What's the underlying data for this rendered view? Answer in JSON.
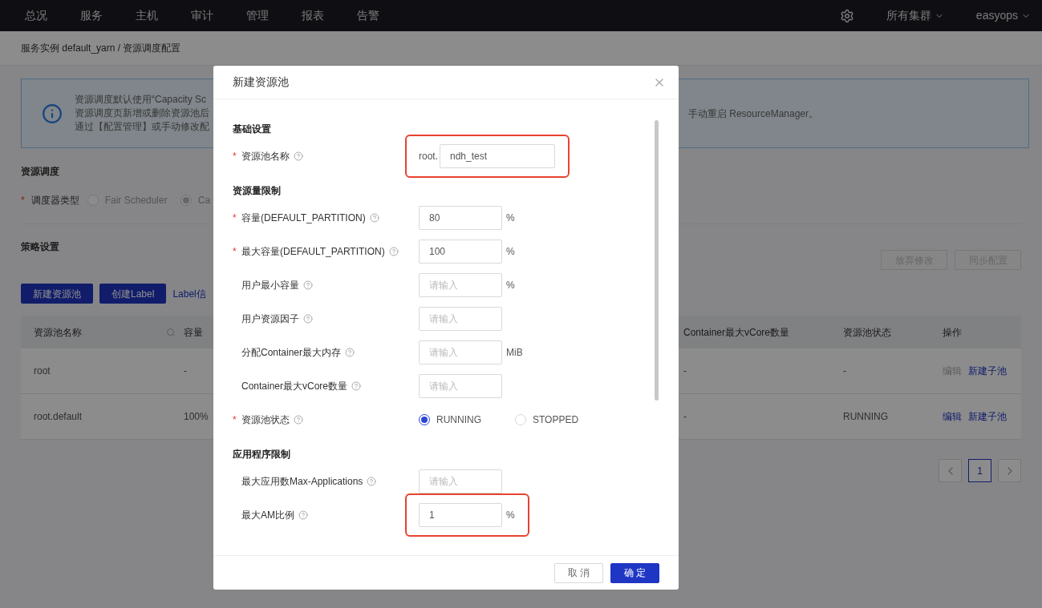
{
  "nav": {
    "items": [
      {
        "label": "总况"
      },
      {
        "label": "服务"
      },
      {
        "label": "主机"
      },
      {
        "label": "审计"
      },
      {
        "label": "管理"
      },
      {
        "label": "报表"
      },
      {
        "label": "告警"
      }
    ],
    "cluster_menu": "所有集群",
    "user_menu": "easyops"
  },
  "breadcrumb": "服务实例 default_yarn / 资源调度配置",
  "notice": {
    "lines": [
      "资源调度默认使用“Capacity Sc",
      "资源调度页新增或删除资源池后",
      "通过【配置管理】或手动修改配"
    ],
    "right_text": "手动重启 ResourceManager。"
  },
  "scheduling": {
    "heading": "资源调度",
    "label": "调度器类型",
    "required_mark": "*",
    "options": [
      {
        "label": "Fair Scheduler",
        "selected": false
      },
      {
        "label": "Ca",
        "selected": true
      }
    ]
  },
  "policy": {
    "heading": "策略设置",
    "actions": [
      {
        "label": "放弃修改",
        "disabled": true
      },
      {
        "label": "同步配置",
        "disabled": true
      }
    ],
    "buttons": [
      "新建资源池",
      "创建Label"
    ],
    "link": "Label信"
  },
  "table": {
    "columns_left": [
      "资源池名称",
      "容量"
    ],
    "columns_right": [
      "Container最大vCore数量",
      "资源池状态",
      "操作"
    ],
    "rows": [
      {
        "name": "root",
        "capacity": "-",
        "max_vcores": "-",
        "status": "-",
        "actions": [
          {
            "label": "编辑",
            "disabled": true
          },
          {
            "label": "新建子池",
            "disabled": false
          }
        ]
      },
      {
        "name": "root.default",
        "capacity": "100%",
        "max_vcores": "-",
        "status": "RUNNING",
        "actions": [
          {
            "label": "编辑",
            "disabled": false
          },
          {
            "label": "新建子池",
            "disabled": false
          }
        ]
      }
    ]
  },
  "pagination": {
    "pages": [
      {
        "label": "1",
        "selected": true
      }
    ]
  },
  "dialog": {
    "title": "新建资源池",
    "sections": [
      {
        "heading": "基础设置",
        "fields": [
          {
            "kind": "prefixed",
            "label": "资源池名称",
            "required_mark": "*",
            "prefix": "root.",
            "value": "ndh_test",
            "highlighted": true
          }
        ]
      },
      {
        "heading": "资源量限制",
        "fields": [
          {
            "kind": "text",
            "label": "容量(DEFAULT_PARTITION)",
            "required_mark": "*",
            "value": "80",
            "unit": "%"
          },
          {
            "kind": "text",
            "label": "最大容量(DEFAULT_PARTITION)",
            "required_mark": "*",
            "value": "100",
            "unit": "%"
          },
          {
            "kind": "text",
            "label": "用户最小容量",
            "placeholder": "请输入",
            "unit": "%"
          },
          {
            "kind": "text",
            "label": "用户资源因子",
            "placeholder": "请输入"
          },
          {
            "kind": "text",
            "label": "分配Container最大内存",
            "placeholder": "请输入",
            "unit": "MiB"
          },
          {
            "kind": "text",
            "label": "Container最大vCore数量",
            "placeholder": "请输入"
          },
          {
            "kind": "radio",
            "label": "资源池状态",
            "required_mark": "*",
            "options": [
              {
                "label": "RUNNING",
                "selected": true
              },
              {
                "label": "STOPPED",
                "selected": false
              }
            ]
          }
        ]
      },
      {
        "heading": "应用程序限制",
        "fields": [
          {
            "kind": "text",
            "label": "最大应用数Max-Applications",
            "placeholder": "请输入"
          },
          {
            "kind": "text",
            "label": "最大AM比例",
            "value": "1",
            "unit": "%",
            "highlighted": true
          }
        ]
      }
    ],
    "buttons": [
      {
        "label": "取 消",
        "kind": "secondary"
      },
      {
        "label": "确 定",
        "kind": "primary"
      }
    ]
  }
}
